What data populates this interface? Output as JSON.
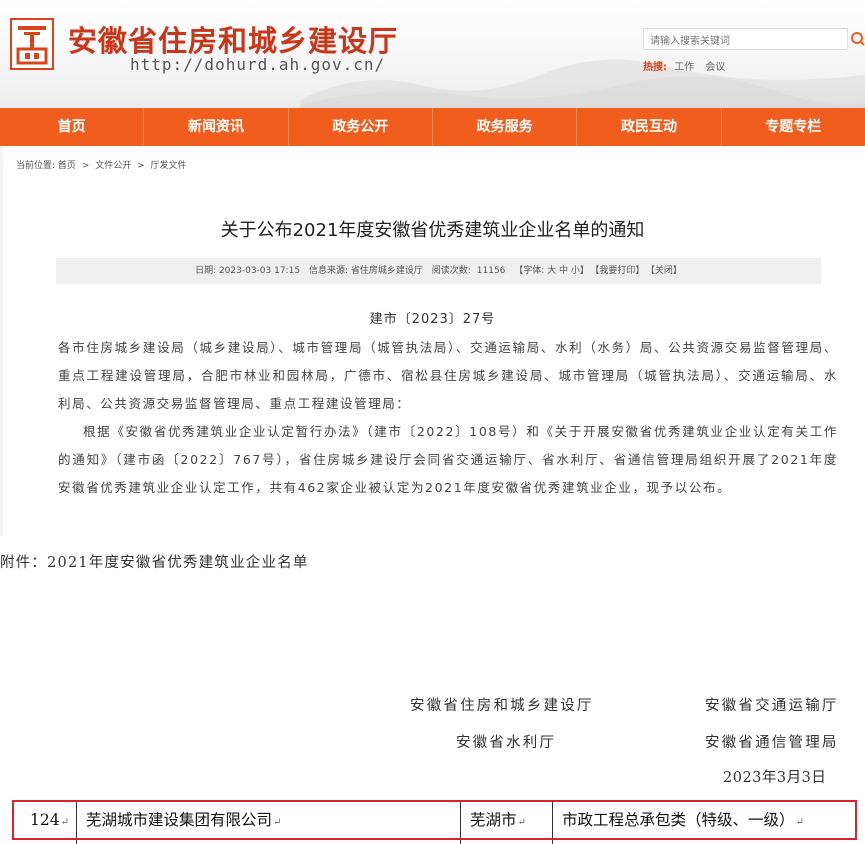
{
  "header": {
    "site_title": "安徽省住房和城乡建设厅",
    "site_url": "http://dohurd.ah.gov.cn/",
    "search_placeholder": "请输入搜索关键词",
    "hot_label": "热搜:",
    "hot_words": [
      "工作",
      "会议"
    ]
  },
  "nav": {
    "items": [
      "首页",
      "新闻资讯",
      "政务公开",
      "政务服务",
      "政民互动",
      "专题专栏"
    ]
  },
  "breadcrumb": {
    "label": "当前位置:",
    "items": [
      "首页",
      "文件公开",
      "厅发文件"
    ],
    "separator": ">"
  },
  "article": {
    "title": "关于公布2021年度安徽省优秀建筑业企业名单的通知",
    "meta": {
      "date": "日期: 2023-03-03 17:15",
      "source": "信息来源: 省住房城乡建设厅",
      "views_label": "阅读次数:",
      "views": "11156",
      "font_size": "【字体: 大 中 小】",
      "print": "【我要打印】",
      "close": "【关闭】"
    },
    "doc_number": "建市〔2023〕27号",
    "recipients": "各市住房城乡建设局（城乡建设局）、城市管理局（城管执法局）、交通运输局、水利（水务）局、公共资源交易监督管理局、重点工程建设管理局，合肥市林业和园林局，广德市、宿松县住房城乡建设局、城市管理局（城管执法局）、交通运输局、水利局、公共资源交易监督管理局、重点工程建设管理局：",
    "paragraph": "根据《安徽省优秀建筑业企业认定暂行办法》（建市〔2022〕108号）和《关于开展安徽省优秀建筑业企业认定有关工作的通知》（建市函〔2022〕767号），省住房城乡建设厅会同省交通运输厅、省水利厅、省通信管理局组织开展了2021年度安徽省优秀建筑业企业认定工作，共有462家企业被认定为2021年度安徽省优秀建筑业企业，现予以公布。"
  },
  "attachment": "附件：2021年度安徽省优秀建筑业企业名单",
  "signatures": {
    "left_1": "安徽省住房和城乡建设厅",
    "right_1": "安徽省交通运输厅",
    "left_2": "安徽省水利厅",
    "right_2": "安徽省通信管理局",
    "date": "2023年3月3日"
  },
  "table_row": {
    "no": "124",
    "company": "芜湖城市建设集团有限公司",
    "city": "芜湖市",
    "category": "市政工程总承包类（特级、一级）",
    "mark": "↵"
  },
  "colors": {
    "brand": "#c9361a",
    "nav": "#f15d1c",
    "highlight_border": "#e0202c"
  }
}
